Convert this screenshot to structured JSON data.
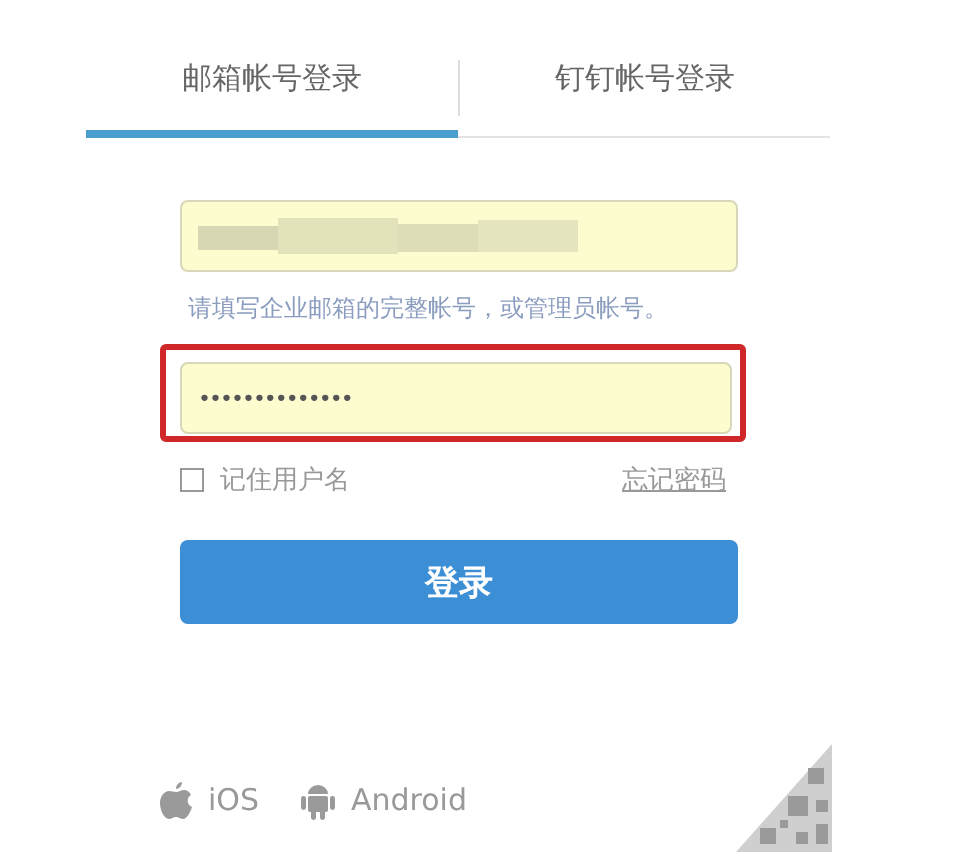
{
  "tabs": [
    {
      "label": "邮箱帐号登录",
      "selected": true
    },
    {
      "label": "钉钉帐号登录",
      "selected": false
    }
  ],
  "email_field": {
    "hint": "请填写企业邮箱的完整帐号，或管理员帐号。"
  },
  "password_field": {
    "value": "••••••••••••••"
  },
  "remember": {
    "label": "记住用户名",
    "checked": false
  },
  "forgot_link": "忘记密码",
  "login_button": "登录",
  "apps": [
    {
      "kind": "apple",
      "label": "iOS"
    },
    {
      "kind": "android",
      "label": "Android"
    }
  ]
}
